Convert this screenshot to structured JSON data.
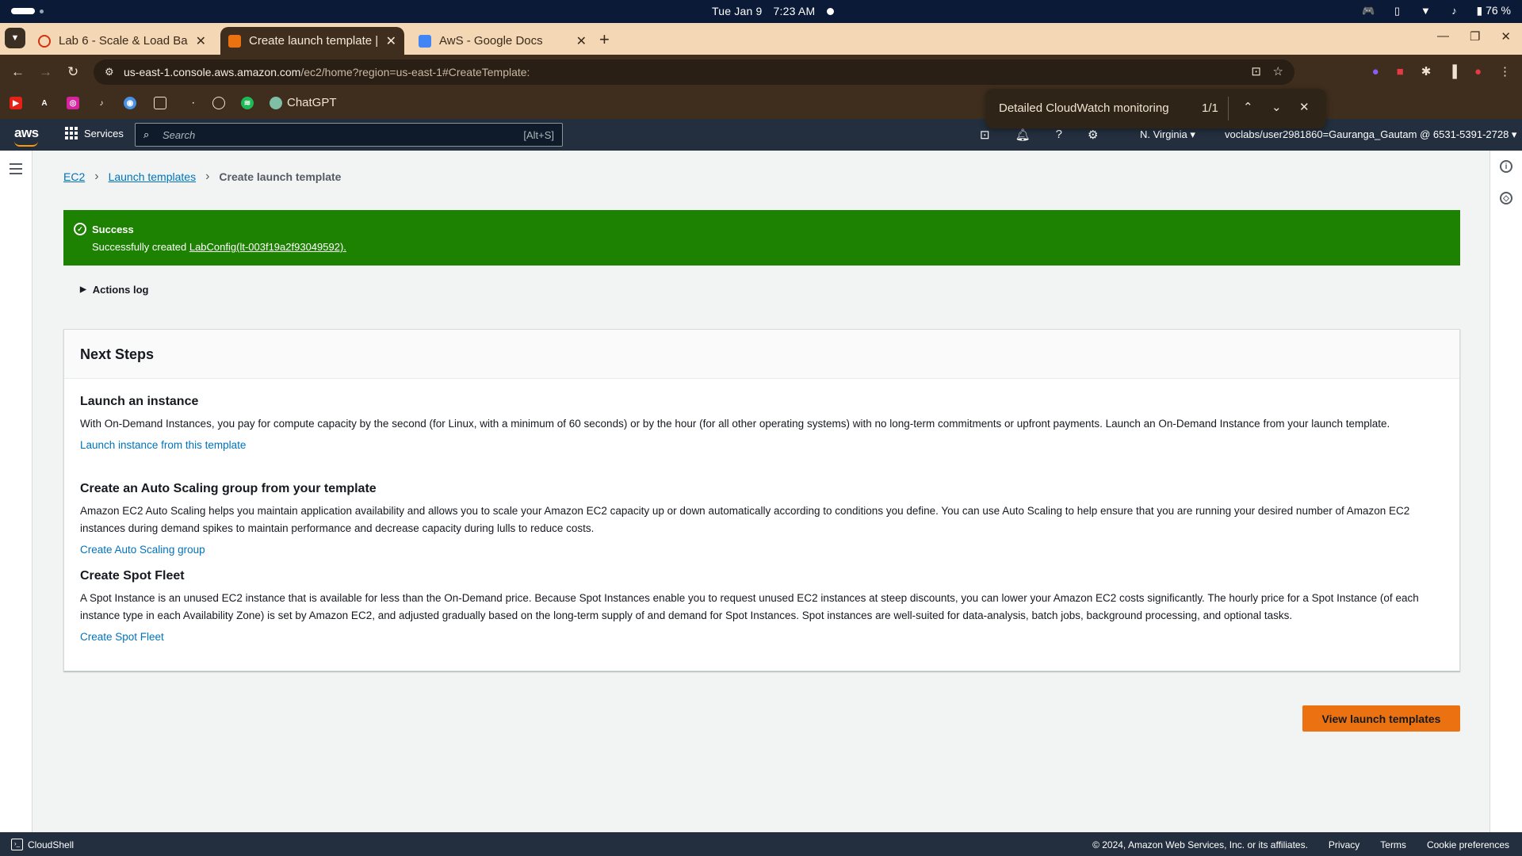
{
  "os": {
    "date": "Tue Jan 9",
    "time": "7:23 AM",
    "battery": "76 %"
  },
  "browser": {
    "tabs": [
      {
        "title": "Lab 6 - Scale & Load Bala",
        "active": false
      },
      {
        "title": "Create launch template |",
        "active": true
      },
      {
        "title": "AwS - Google Docs",
        "active": false
      }
    ],
    "url_host": "us-east-1.console.aws.amazon.com",
    "url_path": "/ec2/home?region=us-east-1#CreateTemplate:",
    "bookmarks": {
      "chatgpt": "ChatGPT"
    },
    "find": {
      "query": "Detailed CloudWatch monitoring",
      "count": "1/1"
    }
  },
  "aws": {
    "logo": "aws",
    "services": "Services",
    "search_placeholder": "Search",
    "search_shortcut": "[Alt+S]",
    "region": "N. Virginia",
    "account": "voclabs/user2981860=Gauranga_Gautam @ 6531-5391-2728"
  },
  "breadcrumb": {
    "root": "EC2",
    "parent": "Launch templates",
    "current": "Create launch template"
  },
  "flash": {
    "title": "Success",
    "prefix": "Successfully created ",
    "link": "LabConfig(lt-003f19a2f93049592).",
    "color": "#1d8102"
  },
  "actions_log": "Actions log",
  "next_steps": {
    "title": "Next Steps",
    "sections": [
      {
        "heading": "Launch an instance",
        "body": "With On-Demand Instances, you pay for compute capacity by the second (for Linux, with a minimum of 60 seconds) or by the hour (for all other operating systems) with no long-term commitments or upfront payments. Launch an On-Demand Instance from your launch template.",
        "link": "Launch instance from this template"
      },
      {
        "heading": "Create an Auto Scaling group from your template",
        "body": "Amazon EC2 Auto Scaling helps you maintain application availability and allows you to scale your Amazon EC2 capacity up or down automatically according to conditions you define. You can use Auto Scaling to help ensure that you are running your desired number of Amazon EC2 instances during demand spikes to maintain performance and decrease capacity during lulls to reduce costs.",
        "link": "Create Auto Scaling group"
      },
      {
        "heading": "Create Spot Fleet",
        "body": "A Spot Instance is an unused EC2 instance that is available for less than the On-Demand price. Because Spot Instances enable you to request unused EC2 instances at steep discounts, you can lower your Amazon EC2 costs significantly. The hourly price for a Spot Instance (of each instance type in each Availability Zone) is set by Amazon EC2, and adjusted gradually based on the long-term supply of and demand for Spot Instances. Spot instances are well-suited for data-analysis, batch jobs, background processing, and optional tasks.",
        "link": "Create Spot Fleet"
      }
    ]
  },
  "primary_button": "View launch templates",
  "footer": {
    "cloudshell": "CloudShell",
    "copyright": "© 2024, Amazon Web Services, Inc. or its affiliates.",
    "privacy": "Privacy",
    "terms": "Terms",
    "cookies": "Cookie preferences"
  }
}
